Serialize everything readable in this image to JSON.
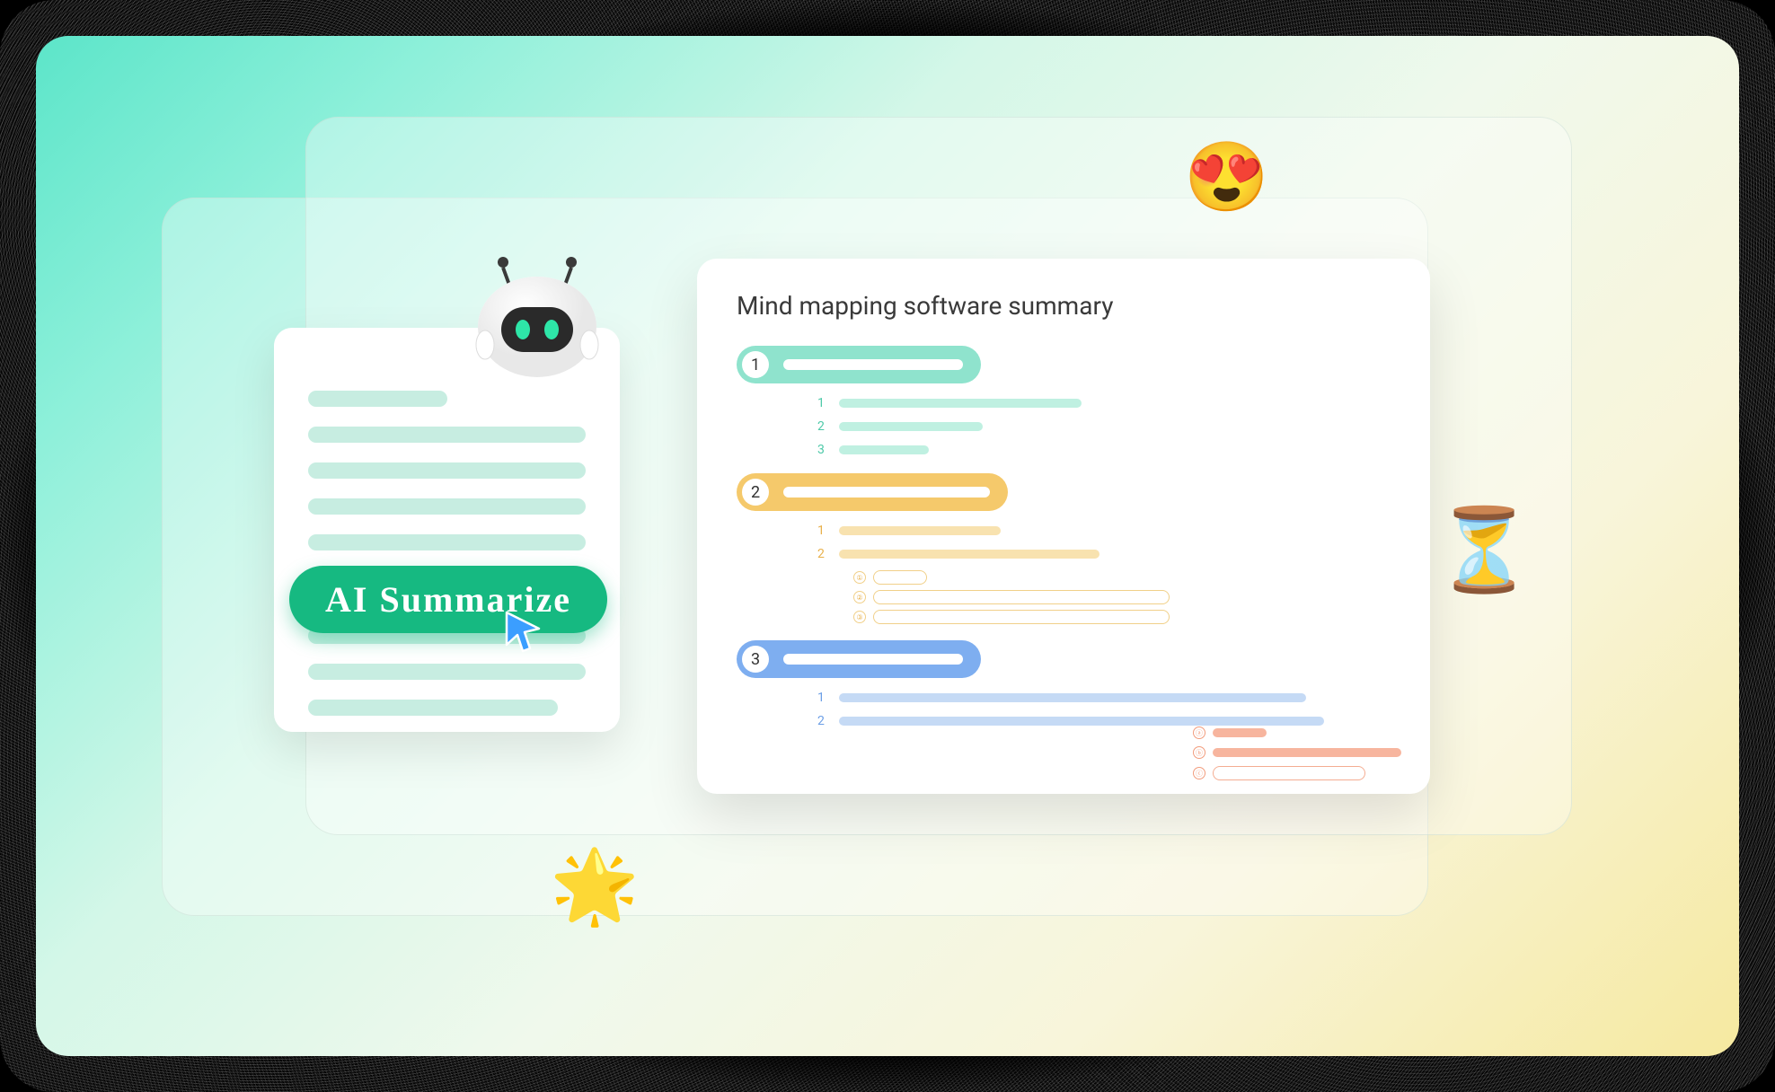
{
  "button": {
    "label": "AI Summarize"
  },
  "summary": {
    "title": "Mind mapping software summary",
    "sections": [
      {
        "number": "1",
        "sub_count": 3
      },
      {
        "number": "2",
        "sub_count": 2
      },
      {
        "number": "3",
        "sub_count": 2
      }
    ]
  },
  "emojis": {
    "heart_eyes": "😍",
    "star": "🌟",
    "hourglass": "⏳"
  }
}
